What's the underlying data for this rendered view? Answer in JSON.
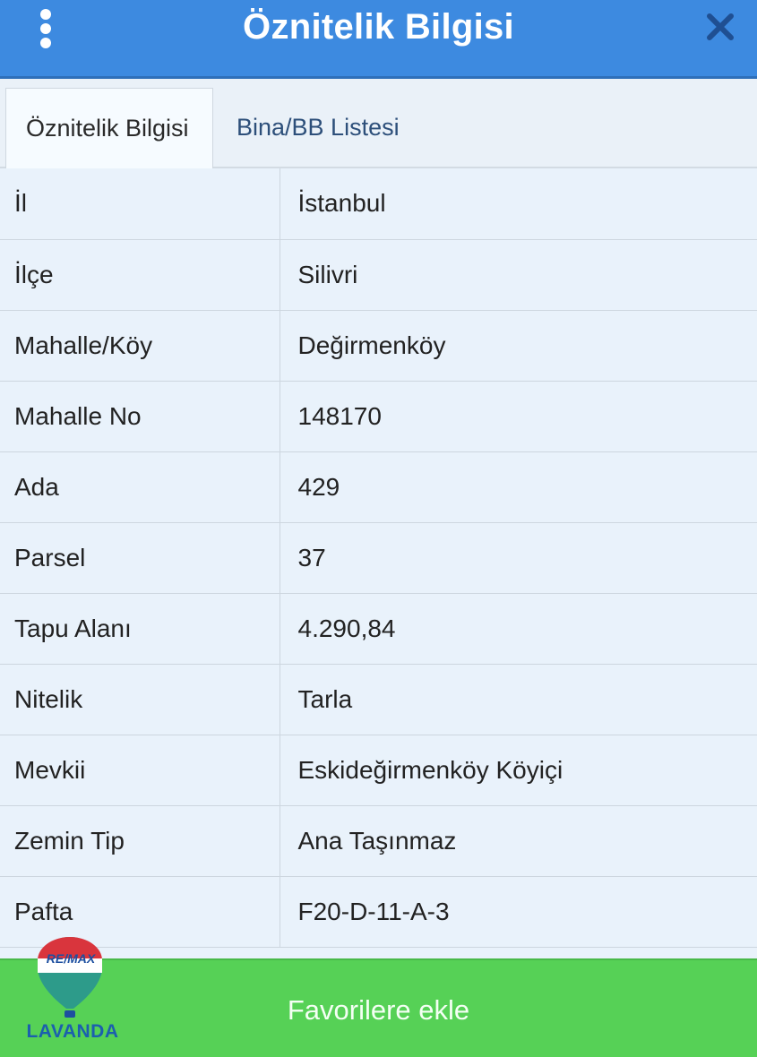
{
  "header": {
    "title": "Öznitelik Bilgisi",
    "menu_icon": "more-vertical-icon",
    "close_icon": "close-icon"
  },
  "tabs": [
    {
      "label": "Öznitelik Bilgisi",
      "active": true
    },
    {
      "label": "Bina/BB Listesi",
      "active": false
    }
  ],
  "attributes": [
    {
      "key": "İl",
      "value": "İstanbul"
    },
    {
      "key": "İlçe",
      "value": "Silivri"
    },
    {
      "key": "Mahalle/Köy",
      "value": "Değirmenköy"
    },
    {
      "key": "Mahalle No",
      "value": "148170"
    },
    {
      "key": "Ada",
      "value": "429"
    },
    {
      "key": "Parsel",
      "value": "37"
    },
    {
      "key": "Tapu Alanı",
      "value": "4.290,84"
    },
    {
      "key": "Nitelik",
      "value": "Tarla"
    },
    {
      "key": "Mevkii",
      "value": "Eskideğirmenköy Köyiçi"
    },
    {
      "key": "Zemin Tip",
      "value": "Ana Taşınmaz"
    },
    {
      "key": "Pafta",
      "value": "F20-D-11-A-3"
    }
  ],
  "footer": {
    "button_label": "Favorilere ekle"
  },
  "logo": {
    "brand": "RE/MAX",
    "name": "LAVANDA"
  },
  "colors": {
    "header": "#3d8ae0",
    "footer": "#56d156",
    "background": "#e9f2fb"
  }
}
